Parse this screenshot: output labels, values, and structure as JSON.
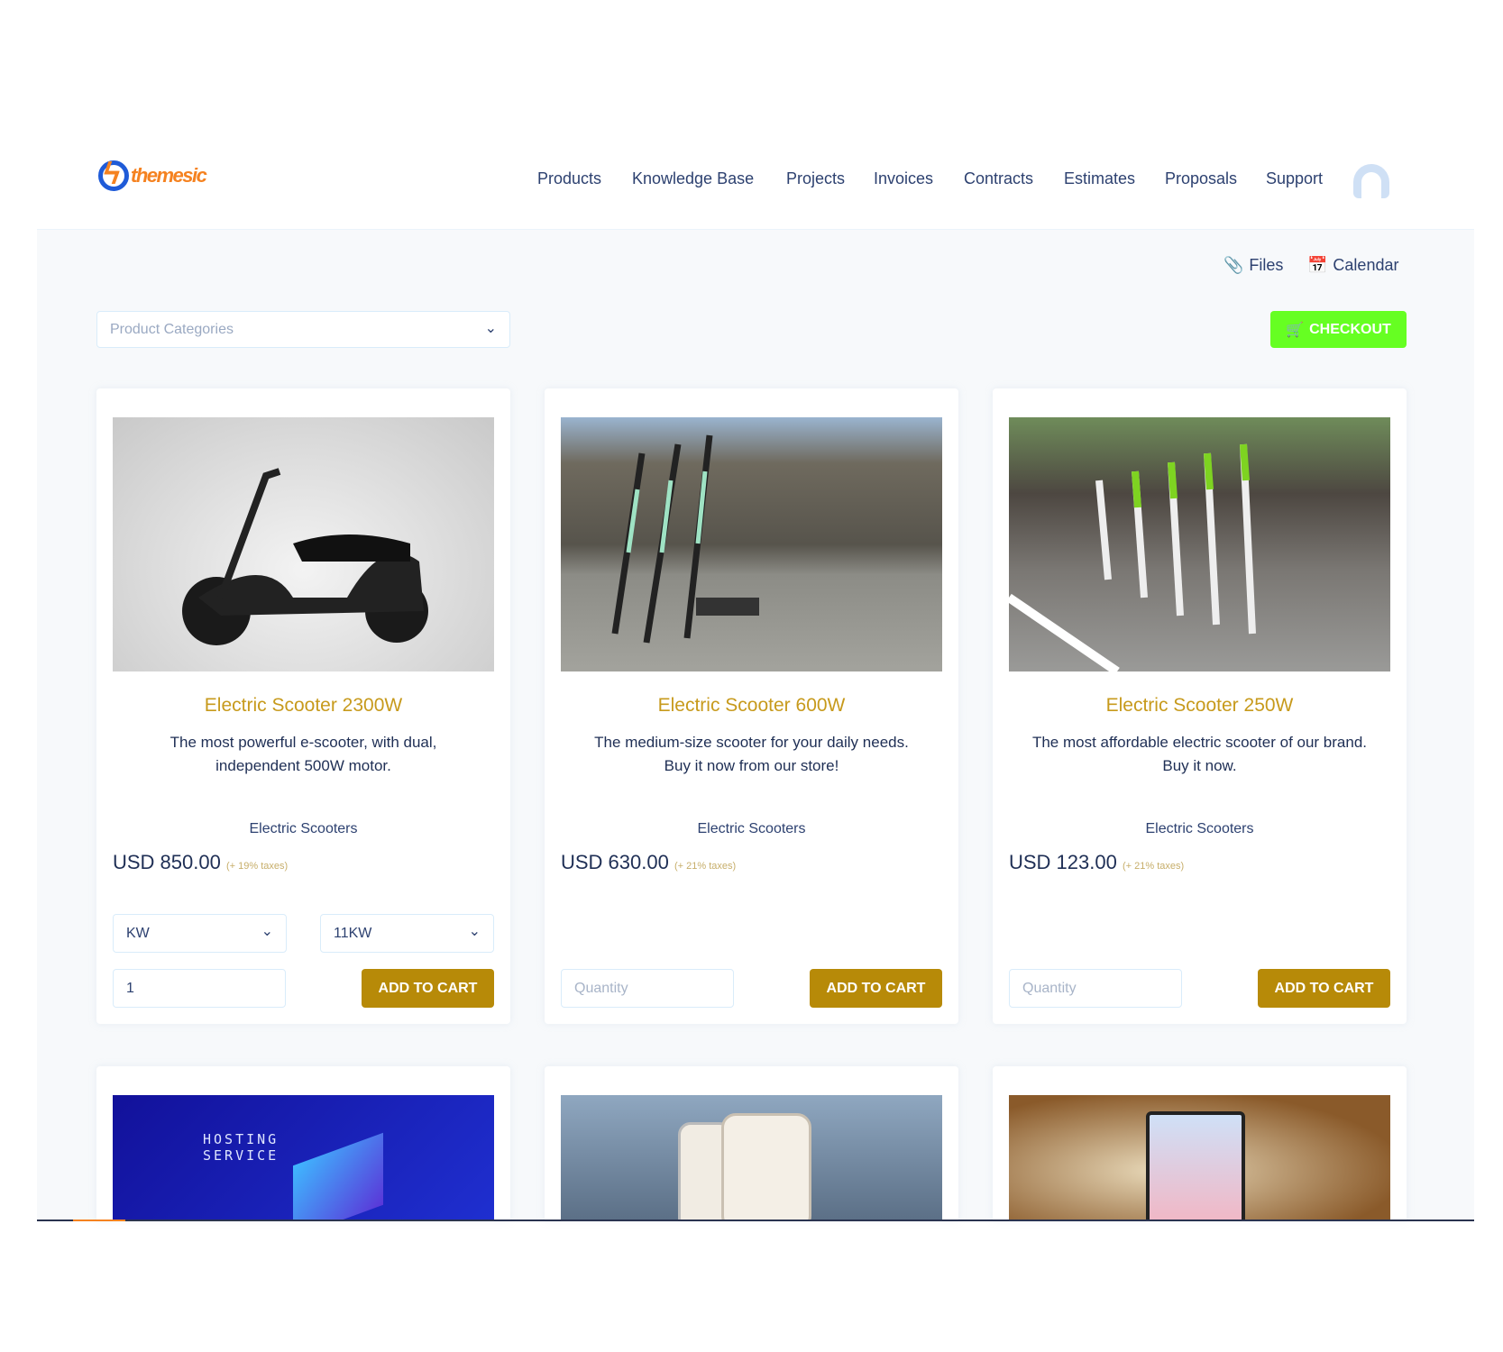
{
  "brand": {
    "logo_text": "themesic"
  },
  "nav": [
    "Products",
    "Knowledge Base",
    "Projects",
    "Invoices",
    "Contracts",
    "Estimates",
    "Proposals",
    "Support"
  ],
  "toolbar": {
    "files": "Files",
    "calendar": "Calendar",
    "checkout": "CHECKOUT"
  },
  "filter": {
    "placeholder": "Product Categories"
  },
  "colors": {
    "accent_gold": "#b78a08",
    "checkout_green": "#66ff22",
    "logo_orange": "#f58220"
  },
  "products": [
    {
      "title": "Electric Scooter 2300W",
      "description": "The most powerful e-scooter, with dual, independent 500W motor.",
      "category": "Electric Scooters",
      "price": "USD 850.00",
      "tax": "(+ 19% taxes)",
      "option1": "KW",
      "option2": "11KW",
      "quantity": "1",
      "quantity_placeholder": "Quantity",
      "button": "ADD TO CART"
    },
    {
      "title": "Electric Scooter 600W",
      "description": "The medium-size scooter for your daily needs. Buy it now from our store!",
      "category": "Electric Scooters",
      "price": "USD 630.00",
      "tax": "(+ 21% taxes)",
      "quantity_placeholder": "Quantity",
      "button": "ADD TO CART"
    },
    {
      "title": "Electric Scooter 250W",
      "description": "The most affordable electric scooter of our brand. Buy it now.",
      "category": "Electric Scooters",
      "price": "USD 123.00",
      "tax": "(+ 21% taxes)",
      "quantity_placeholder": "Quantity",
      "button": "ADD TO CART"
    }
  ],
  "row2": [
    {
      "image_text": "HOSTING SERVICE"
    },
    {},
    {}
  ]
}
